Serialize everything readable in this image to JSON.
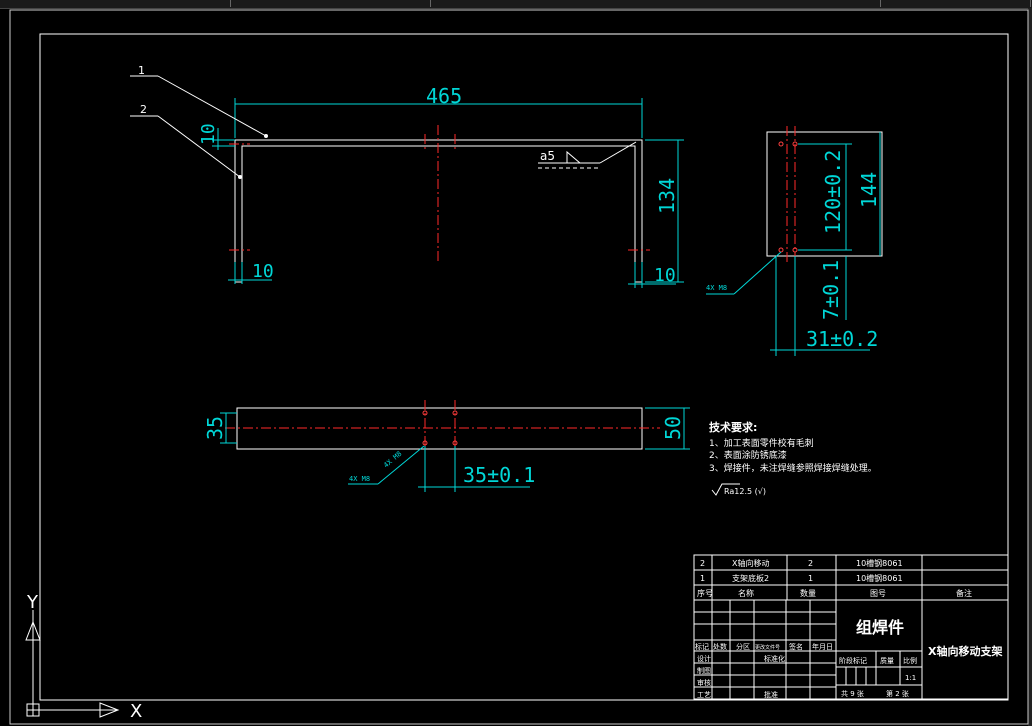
{
  "window": {
    "title_bar_segments": 4
  },
  "drawing": {
    "leaders": {
      "part1": "1",
      "part2": "2"
    },
    "front_view": {
      "dim_length": "465",
      "dim_thickness_top": "10",
      "dim_height": "134",
      "dim_left_leg": "10",
      "dim_right_leg": "10",
      "weld_symbol": "a5"
    },
    "side_view": {
      "dim_hole_spacing": "120±0.2",
      "dim_height": "144",
      "dim_offset": "7±0.1",
      "dim_width": "31±0.2",
      "hole_note": "4X M8"
    },
    "top_view": {
      "dim_left": "35",
      "dim_right": "50",
      "dim_hole_spacing": "35±0.1",
      "hole_note": "4X M8",
      "hole_note2": "4X M8"
    },
    "tech_req": {
      "title": "技术要求:",
      "items": [
        "1、加工表面零件校有毛刺",
        "2、表面涂防锈底漆",
        "3、焊接件，未注焊缝参照焊接焊缝处理。"
      ],
      "roughness": "Ra12.5 (√)"
    },
    "ucs": {
      "x_label": "X",
      "y_label": "Y"
    }
  },
  "title_block": {
    "parts": [
      {
        "no": "2",
        "name": "X轴向移动",
        "qty": "2",
        "material": "10槽钢8061"
      },
      {
        "no": "1",
        "name": "支架底板2",
        "qty": "1",
        "material": "10槽钢8061"
      }
    ],
    "header": {
      "no": "序号",
      "name": "名称",
      "qty": "数量",
      "material": "图号",
      "remark": "备注"
    },
    "part_type": "组焊件",
    "drawing_name": "X轴向移动支架",
    "revision_row": [
      "标记",
      "处数",
      "分区",
      "更改文件号",
      "签名",
      "年月日"
    ],
    "sign_rows": [
      "设计",
      "制图",
      "审核",
      "工艺"
    ],
    "std_label": "标准化",
    "approve_label": "批准",
    "stage_labels": [
      "阶段标记",
      "质量",
      "比例"
    ],
    "scale": "1:1",
    "sheets_total": "共 9 张",
    "sheet_no": "第 2 张"
  }
}
